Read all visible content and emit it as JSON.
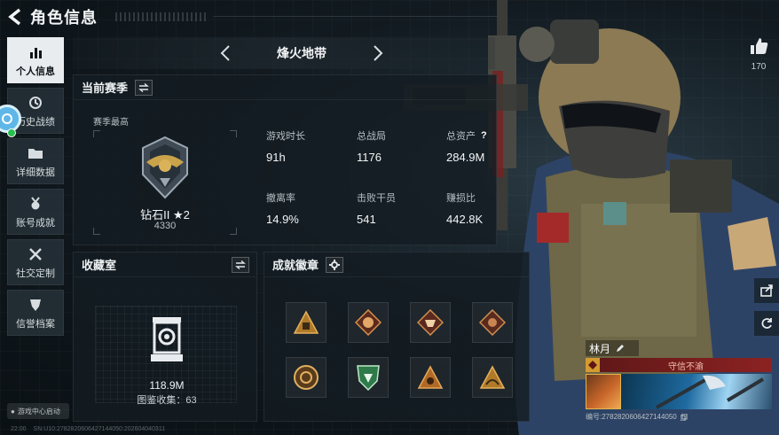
{
  "header": {
    "title": "角色信息"
  },
  "sidebar": {
    "items": [
      {
        "label": "个人信息",
        "icon": "bar-chart-icon",
        "active": true
      },
      {
        "label": "历史战绩",
        "icon": "history-clock-icon",
        "active": false
      },
      {
        "label": "详细数据",
        "icon": "folder-icon",
        "active": false
      },
      {
        "label": "账号成就",
        "icon": "medal-icon",
        "active": false
      },
      {
        "label": "社交定制",
        "icon": "tools-icon",
        "active": false
      },
      {
        "label": "信誉档案",
        "icon": "shield-icon",
        "active": false
      }
    ],
    "game_center_label": "游戏中心启动"
  },
  "map_nav": {
    "current": "烽火地带"
  },
  "season": {
    "title": "当前赛季",
    "sub_label": "赛季最高",
    "rank_name": "钻石II ★2",
    "rank_score": "4330",
    "stats": [
      {
        "label": "游戏时长",
        "value": "91h"
      },
      {
        "label": "总战局",
        "value": "1176"
      },
      {
        "label": "总资产",
        "value": "284.9M",
        "help": "?"
      },
      {
        "label": "撤离率",
        "value": "14.9%"
      },
      {
        "label": "击败干员",
        "value": "541"
      },
      {
        "label": "赚损比",
        "value": "442.8K"
      }
    ]
  },
  "collection": {
    "title": "收藏室",
    "value": "118.9M",
    "count_label": "图鉴收集：63"
  },
  "achievements": {
    "title": "成就徽章",
    "badges": [
      "triangle-badge-icon",
      "creature-badge-icon",
      "beast-badge-icon",
      "partial-badge-icon",
      "round-badge-icon",
      "green-shield-badge-icon",
      "triangle-eye-badge-icon",
      "triangle-bridge-badge-icon"
    ]
  },
  "social": {
    "like_count": "170"
  },
  "player": {
    "name": "林月",
    "title_text": "守信不渝",
    "id_text": "编号:2782820606427144050",
    "accent": "#8c2222"
  },
  "status_bar": {
    "time": "22:00",
    "serial": "SN:U10:2782820606427144050:202604040311"
  },
  "colors": {
    "active_tab": "#e9ecee",
    "badge_gold": "#d59b2f",
    "panel_bg": "#141c22"
  }
}
